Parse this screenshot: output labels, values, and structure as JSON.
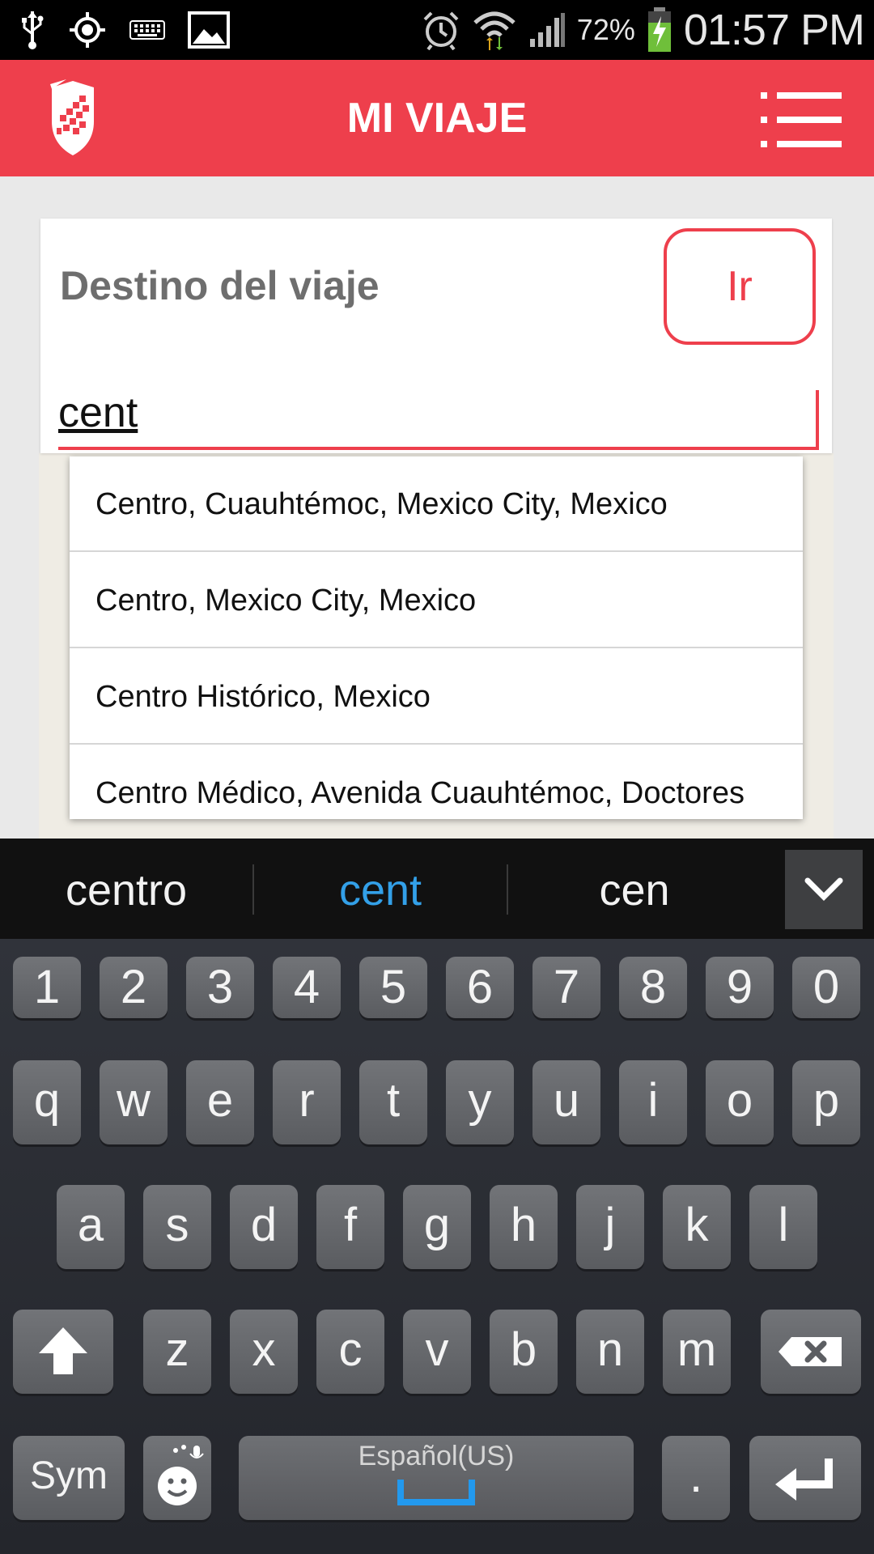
{
  "status_bar": {
    "battery_percent": "72%",
    "time": "01:57 PM",
    "icons_left": [
      "usb-icon",
      "location-icon",
      "keyboard-icon",
      "image-icon"
    ],
    "icons_right": [
      "alarm-icon",
      "wifi-icon",
      "signal-icon",
      "battery-charging-icon"
    ]
  },
  "app_bar": {
    "title": "MI VIAJE",
    "logo_icon": "shield-logo-icon",
    "menu_icon": "list-menu-icon",
    "color": "#ee3f4c"
  },
  "card": {
    "title": "Destino del viaje",
    "go_button_label": "Ir",
    "search_value": "cent"
  },
  "suggestions": [
    "Centro, Cuauhtémoc, Mexico City, Mexico",
    "Centro, Mexico City, Mexico",
    "Centro Histórico, Mexico",
    "Centro Médico, Avenida Cuauhtémoc, Doctores"
  ],
  "keyboard": {
    "predictions": [
      "centro",
      "cent",
      "cen"
    ],
    "highlight_color": "#33a0e8",
    "numbers": [
      "1",
      "2",
      "3",
      "4",
      "5",
      "6",
      "7",
      "8",
      "9",
      "0"
    ],
    "row1": [
      "q",
      "w",
      "e",
      "r",
      "t",
      "y",
      "u",
      "i",
      "o",
      "p"
    ],
    "row2": [
      "a",
      "s",
      "d",
      "f",
      "g",
      "h",
      "j",
      "k",
      "l"
    ],
    "row3": [
      "z",
      "x",
      "c",
      "v",
      "b",
      "n",
      "m"
    ],
    "sym_label": "Sym",
    "space_label": "Español(US)",
    "period_label": "."
  }
}
